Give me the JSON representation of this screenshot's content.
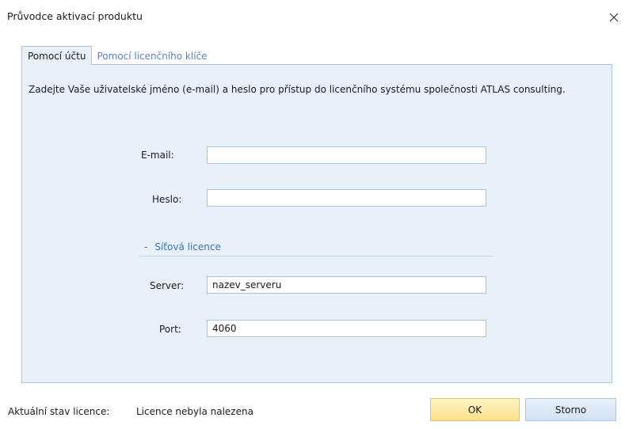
{
  "window": {
    "title": "Průvodce aktivací produktu"
  },
  "tabs": [
    {
      "label": "Pomocí účtu",
      "active": true
    },
    {
      "label": "Pomocí licenčního klíče",
      "active": false
    }
  ],
  "account_tab": {
    "instruction": "Zadejte Vaše uživatelské jméno (e-mail) a heslo pro přístup do licenčního systému společnosti ATLAS consulting.",
    "email_label": "E-mail:",
    "email_value": "",
    "password_label": "Heslo:",
    "password_value": "",
    "network_section": {
      "toggle_symbol": "-",
      "title": "Síťová licence"
    },
    "server_label": "Server:",
    "server_value": "nazev_serveru",
    "port_label": "Port:",
    "port_value": "4060"
  },
  "footer": {
    "status_label": "Aktuální stav licence:",
    "status_value": "Licence nebyla nalezena",
    "ok_label": "OK",
    "cancel_label": "Storno"
  },
  "colors": {
    "panel_bg": "#e8f0f9",
    "panel_border": "#a9c3e3",
    "accent_link": "#3d74c1",
    "ok_button": "#fde08a"
  }
}
